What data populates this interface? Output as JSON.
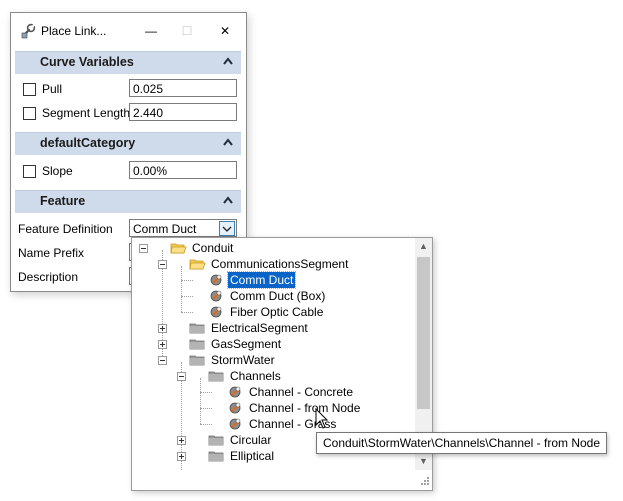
{
  "window": {
    "title": "Place Link...",
    "buttons": {
      "minimize": "—",
      "maximize": "☐",
      "close": "✕"
    }
  },
  "sections": {
    "curve_variables": {
      "title": "Curve Variables",
      "pull": {
        "label": "Pull",
        "value": "0.025",
        "checked": false
      },
      "segment_length": {
        "label": "Segment Length",
        "value": "2.440",
        "checked": false
      }
    },
    "default_category": {
      "title": "defaultCategory",
      "slope": {
        "label": "Slope",
        "value": "0.00%",
        "checked": false
      }
    },
    "feature": {
      "title": "Feature",
      "feature_definition": {
        "label": "Feature Definition",
        "value": "Comm Duct"
      },
      "name_prefix": {
        "label": "Name Prefix"
      },
      "description": {
        "label": "Description"
      }
    }
  },
  "tree": {
    "items": [
      {
        "label": "Conduit",
        "icon": "folder-open-icon",
        "level": 0,
        "expander": "minus"
      },
      {
        "label": "CommunicationsSegment",
        "icon": "folder-open-icon",
        "level": 1,
        "expander": "minus"
      },
      {
        "label": "Comm Duct",
        "icon": "feature-icon",
        "level": 2,
        "selected": true
      },
      {
        "label": "Comm Duct (Box)",
        "icon": "feature-icon",
        "level": 2
      },
      {
        "label": "Fiber Optic Cable",
        "icon": "feature-icon",
        "level": 2
      },
      {
        "label": "ElectricalSegment",
        "icon": "folder-closed-icon",
        "level": 1,
        "expander": "plus"
      },
      {
        "label": "GasSegment",
        "icon": "folder-closed-icon",
        "level": 1,
        "expander": "plus"
      },
      {
        "label": "StormWater",
        "icon": "folder-closed-icon",
        "level": 1,
        "expander": "minus"
      },
      {
        "label": "Channels",
        "icon": "folder-closed-icon",
        "level": 2,
        "expander": "minus"
      },
      {
        "label": "Channel - Concrete",
        "icon": "feature-icon",
        "level": 3
      },
      {
        "label": "Channel - from Node",
        "icon": "feature-icon",
        "level": 3
      },
      {
        "label": "Channel - Grass",
        "icon": "feature-icon",
        "level": 3
      },
      {
        "label": "Circular",
        "icon": "folder-closed-icon",
        "level": 2,
        "expander": "plus"
      },
      {
        "label": "Elliptical",
        "icon": "folder-closed-icon",
        "level": 2,
        "expander": "plus"
      }
    ]
  },
  "tooltip": "Conduit\\StormWater\\Channels\\Channel - from Node",
  "colors": {
    "section_header": "#cfdbea",
    "selection": "#0a64c8",
    "folder": "#f3c955",
    "folder_closed": "#9a9a9a"
  }
}
